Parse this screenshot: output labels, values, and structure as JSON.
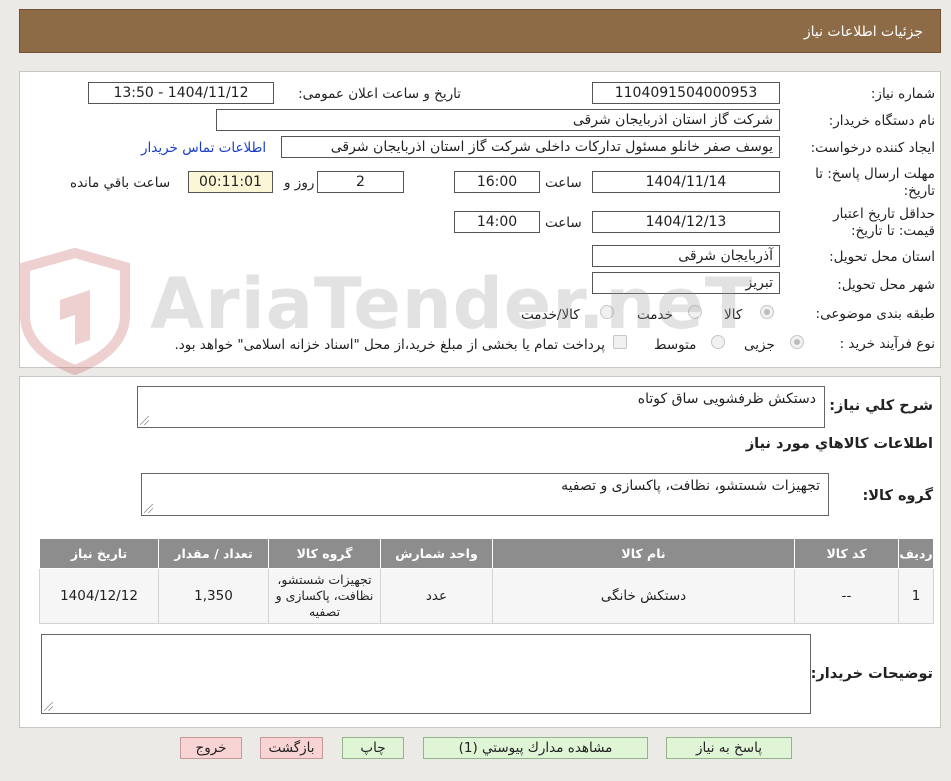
{
  "header": {
    "title": "جزئیات اطلاعات نیاز"
  },
  "form": {
    "need_number_label": "شماره نیاز:",
    "need_number": "1104091504000953",
    "announce_label": "تاریخ و ساعت اعلان عمومی:",
    "announce_value": "1404/11/12 - 13:50",
    "buyer_label": "نام دستگاه خریدار:",
    "buyer_value": "شرکت گاز استان اذربایجان شرقی",
    "requester_label": "ایجاد کننده درخواست:",
    "requester_value": "یوسف صفر خانلو  مسئول تدارکات داخلی  شرکت گاز استان اذربایجان شرقی",
    "contact_link": "اطلاعات تماس خریدار",
    "deadline_label_1": "مهلت ارسال پاسخ: تا",
    "deadline_label_2": "تاریخ:",
    "deadline_date": "1404/11/14",
    "time_label": "ساعت",
    "deadline_time": "16:00",
    "days_value": "2",
    "days_label": "روز و",
    "remaining_time": "00:11:01",
    "remaining_label": "ساعت باقي مانده",
    "validity_label_1": "حداقل تاریخ اعتبار",
    "validity_label_2": "قیمت: تا تاریخ:",
    "validity_date": "1404/12/13",
    "validity_time_label": "ساعت",
    "validity_time": "14:00",
    "province_label": "استان محل تحویل:",
    "province_value": "آذربایجان شرقی",
    "city_label": "شهر محل تحویل:",
    "city_value": "تبریز",
    "category_label": "طبقه بندی موضوعی:",
    "category_options": [
      "کالا",
      "خدمت",
      "کالا/خدمت"
    ],
    "process_label": "نوع فرآیند خرید :",
    "process_options": [
      "جزیی",
      "متوسط"
    ],
    "payment_note": "پرداخت تمام یا بخشی از مبلغ خرید،از محل \"اسناد خزانه اسلامی\" خواهد بود."
  },
  "details": {
    "summary_label": "شرح کلي نياز:",
    "summary_value": "دستکش ظرفشویی ساق کوتاه",
    "goods_info_title": "اطلاعات کالاهاي مورد نياز",
    "goods_group_label": "گروه کالا:",
    "goods_group_value": "تجهیزات شستشو، نظافت، پاکسازی و تصفیه",
    "table": {
      "headers": [
        "رديف",
        "کد کالا",
        "نام کالا",
        "واحد شمارش",
        "گروه کالا",
        "تعداد / مقدار",
        "تاریخ نیاز"
      ],
      "rows": [
        [
          "1",
          "--",
          "دستکش خانگی",
          "عدد",
          "تجهیزات شستشو، نظافت، پاکسازی و تصفیه",
          "1,350",
          "1404/12/12"
        ]
      ]
    },
    "buyer_notes_label": "توضیحات خریدار:",
    "buyer_notes_value": ""
  },
  "buttons": {
    "reply": "پاسخ به نیاز",
    "attachments": "مشاهده مدارك پيوستي (1)",
    "print": "چاپ",
    "back": "بازگشت",
    "exit": "خروج"
  },
  "watermark": {
    "text": "AriaTender.neT"
  },
  "colors": {
    "header": "#8d6b46",
    "link": "#1a3cc8",
    "table_header": "#8d8d8d",
    "green_button": "#dff5d6",
    "pink_button": "#f9d4d4"
  }
}
